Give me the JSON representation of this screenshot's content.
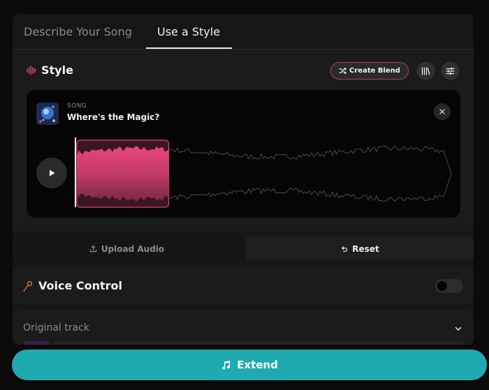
{
  "tabs": [
    {
      "label": "Describe Your Song",
      "active": false
    },
    {
      "label": "Use a Style",
      "active": true
    }
  ],
  "style_section": {
    "title": "Style",
    "create_blend_label": "Create Blend",
    "icons": [
      "soundwave-icon",
      "library-icon",
      "sliders-icon"
    ]
  },
  "song": {
    "type_label": "SONG",
    "name": "Where's the Magic?",
    "selection_fraction": 0.25
  },
  "actions": {
    "upload_label": "Upload Audio",
    "reset_label": "Reset"
  },
  "voice_control": {
    "title": "Voice Control",
    "enabled": false
  },
  "original_track": {
    "title": "Original track"
  },
  "extend": {
    "label": "Extend"
  },
  "colors": {
    "accent_pink": "#e0456f",
    "accent_teal": "#1fa9b1",
    "voice_icon": "#d9773a"
  }
}
